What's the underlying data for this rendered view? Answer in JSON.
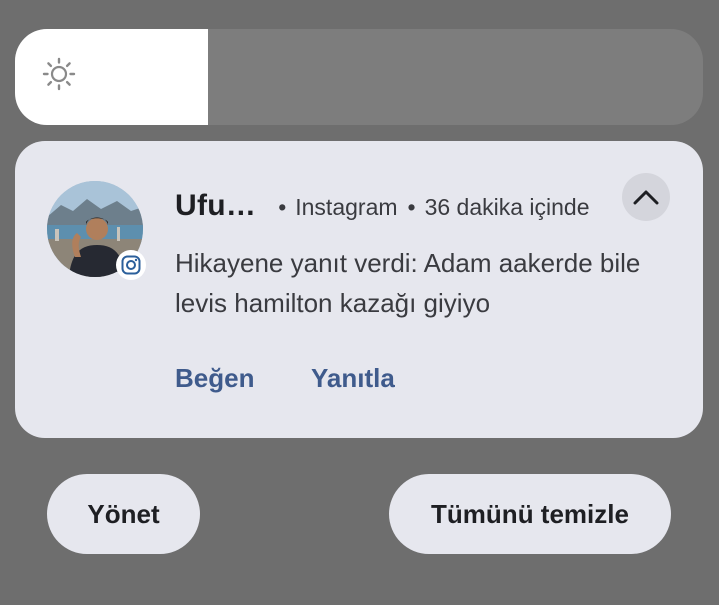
{
  "brightness": {
    "level_percent": 28,
    "icon": "sun-icon"
  },
  "notification": {
    "sender": "Ufu…",
    "app_name": "Instagram",
    "time": "36 dakika içinde",
    "separator": "•",
    "message": "Hikayene yanıt verdi: Adam aakerde bile levis hamilton kazağı giyiyo",
    "app_icon": "instagram-icon",
    "collapse_icon": "chevron-up-icon",
    "actions": {
      "like": "Beğen",
      "reply": "Yanıtla"
    }
  },
  "footer": {
    "manage": "Yönet",
    "clear_all": "Tümünü temizle"
  },
  "colors": {
    "background": "#6e6e6e",
    "card": "#e6e7ee",
    "action_text": "#3f5b8c"
  }
}
